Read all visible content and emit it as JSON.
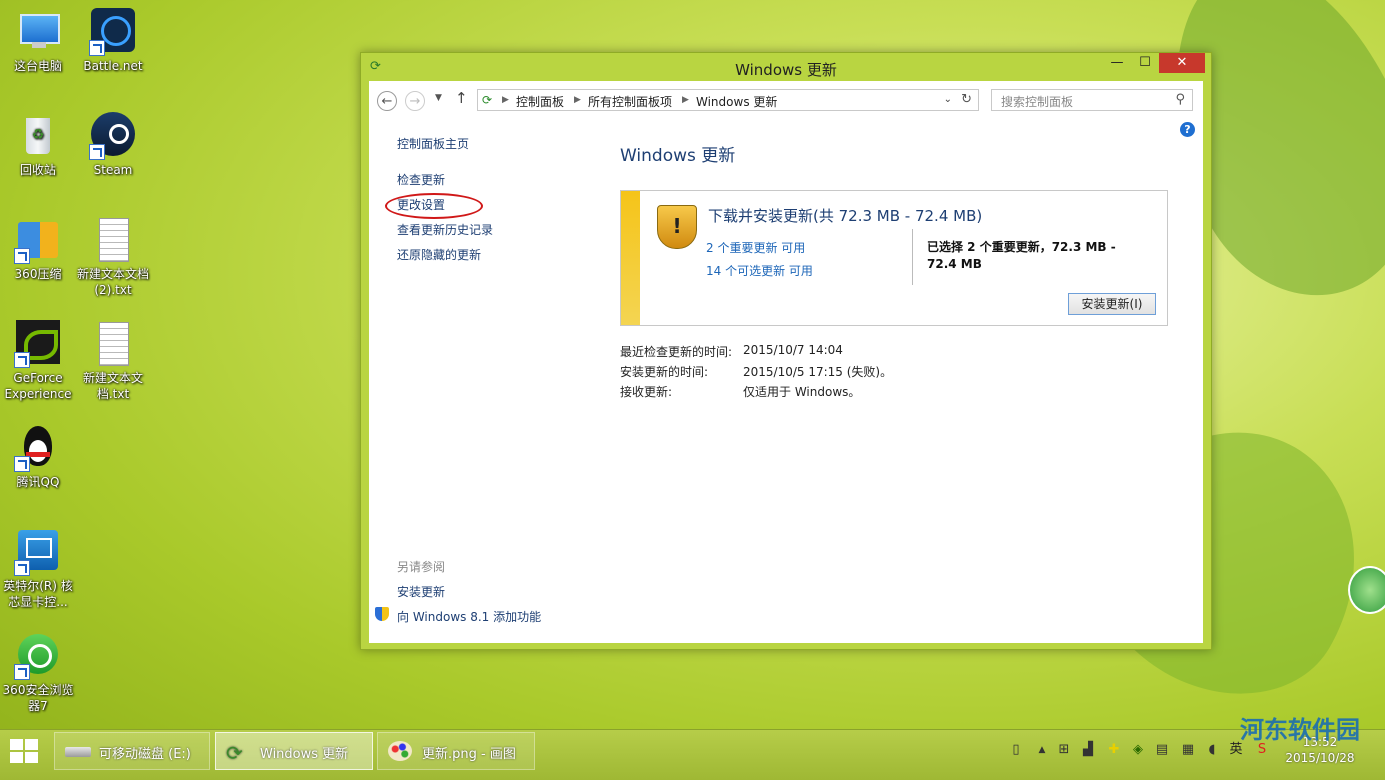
{
  "desktop": {
    "icons": [
      {
        "label": "这台电脑"
      },
      {
        "label": "Battle.net"
      },
      {
        "label": "回收站"
      },
      {
        "label": "Steam"
      },
      {
        "label": "360压缩"
      },
      {
        "label": "新建文本文档 (2).txt"
      },
      {
        "label": "GeForce Experience"
      },
      {
        "label": "新建文本文档.txt"
      },
      {
        "label": "腾讯QQ"
      },
      {
        "label": "英特尔(R) 核芯显卡控..."
      },
      {
        "label": "360安全浏览器7"
      }
    ]
  },
  "window": {
    "title": "Windows 更新",
    "minimize": "—",
    "maximize": "☐",
    "close": "✕",
    "address": {
      "crumbs": [
        "控制面板",
        "所有控制面板项",
        "Windows 更新"
      ]
    },
    "search_placeholder": "搜索控制面板",
    "sidebar": {
      "home": "控制面板主页",
      "items": [
        "检查更新",
        "更改设置",
        "查看更新历史记录",
        "还原隐藏的更新"
      ],
      "see_also": "另请参阅",
      "see_also_items": [
        "安装更新",
        "向 Windows 8.1 添加功能"
      ]
    },
    "heading": "Windows 更新",
    "panel": {
      "title": "下载并安装更新(共 72.3 MB - 72.4 MB)",
      "important": "2 个重要更新 可用",
      "optional": "14 个可选更新 可用",
      "selected": "已选择 2 个重要更新，72.3 MB - 72.4 MB",
      "install_button": "安装更新(I)"
    },
    "info": [
      {
        "label": "最近检查更新的时间:",
        "value": "2015/10/7 14:04"
      },
      {
        "label": "安装更新的时间:",
        "value": "2015/10/5 17:15 (失败)。"
      },
      {
        "label": "接收更新:",
        "value": "仅适用于 Windows。"
      }
    ]
  },
  "taskbar": {
    "buttons": [
      {
        "label": "可移动磁盘 (E:)"
      },
      {
        "label": "Windows 更新"
      },
      {
        "label": "更新.png - 画图"
      }
    ],
    "ime": "英",
    "time": "13:52",
    "date": "2015/10/28"
  },
  "watermark": "河东软件园",
  "colors": {
    "accent": "#1e3f73",
    "close_red": "#c7382c",
    "warning_bar": "#f5c419",
    "highlight_ring": "#d01818"
  }
}
